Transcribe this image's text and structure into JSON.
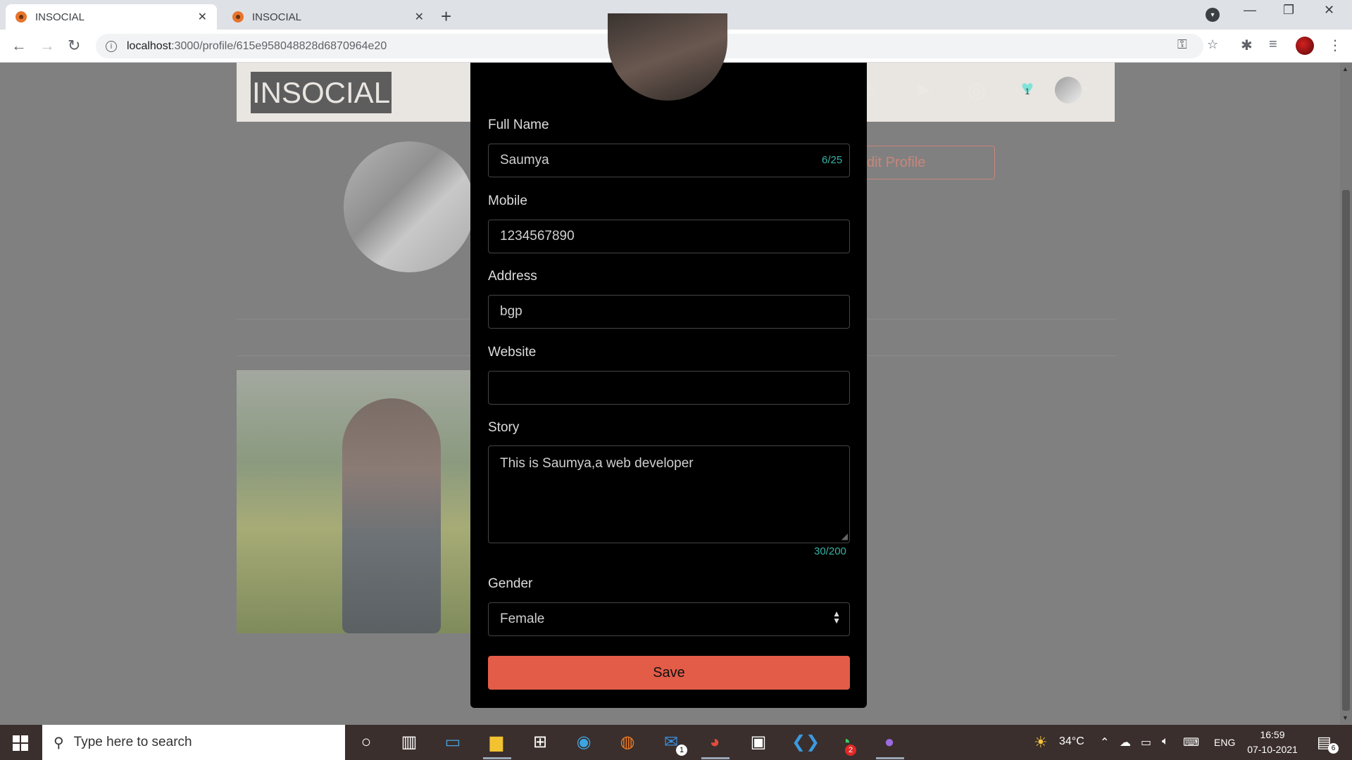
{
  "browser": {
    "tabs": [
      {
        "title": "INSOCIAL",
        "active": true
      },
      {
        "title": "INSOCIAL",
        "active": false
      }
    ],
    "url_host": "localhost",
    "url_path": ":3000/profile/615e958048828d6870964e20",
    "icons": {
      "back": "←",
      "forward": "→",
      "reload": "↻",
      "new_tab": "+",
      "minimize": "—",
      "restore": "❐",
      "close": "✕",
      "tab_close": "✕",
      "key": "⚿",
      "star": "☆",
      "extensions": "✱",
      "media": "≡",
      "menu": "⋮",
      "profile_menu": "▾",
      "info": "i"
    }
  },
  "site": {
    "brand": "INSOCIAL",
    "notifications_count": "1",
    "edit_profile_label": "dit Profile",
    "nav_icons": [
      "⌂",
      "➤",
      "◎"
    ]
  },
  "modal": {
    "full_name_label": "Full Name",
    "full_name_value": "Saumya",
    "full_name_counter": "6/25",
    "mobile_label": "Mobile",
    "mobile_value": "1234567890",
    "address_label": "Address",
    "address_value": "bgp",
    "website_label": "Website",
    "website_value": "",
    "story_label": "Story",
    "story_value": "This is Saumya,a web developer",
    "story_counter": "30/200",
    "gender_label": "Gender",
    "gender_value": "Female",
    "save_label": "Save"
  },
  "taskbar": {
    "search_placeholder": "Type here to search",
    "weather": "34°C",
    "language": "ENG",
    "time": "16:59",
    "date": "07-10-2021",
    "mail_badge": "1",
    "whatsapp_badge": "2",
    "notification_count": "6"
  },
  "colors": {
    "accent": "#e35c47",
    "counter": "#36b3a6",
    "overlay": "#808080"
  }
}
